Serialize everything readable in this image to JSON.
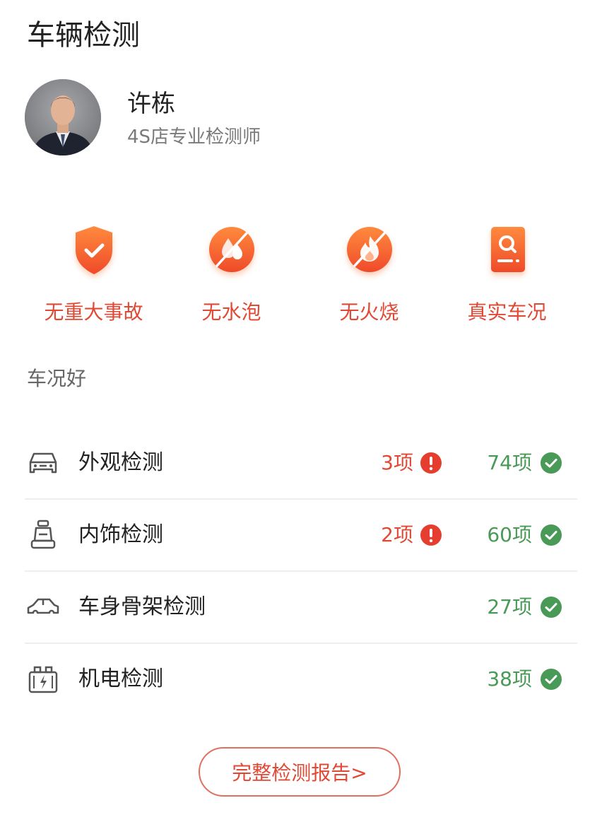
{
  "page": {
    "title": "车辆检测"
  },
  "inspector": {
    "name": "许栋",
    "title": "4S店专业检测师"
  },
  "badges": [
    {
      "icon": "shield-check-icon",
      "label": "无重大事故"
    },
    {
      "icon": "no-water-icon",
      "label": "无水泡"
    },
    {
      "icon": "no-fire-icon",
      "label": "无火烧"
    },
    {
      "icon": "report-search-icon",
      "label": "真实车况"
    }
  ],
  "summary": {
    "status": "车况好"
  },
  "items": [
    {
      "icon": "car-front-icon",
      "label": "外观检测",
      "warn": "3项",
      "pass": "74项"
    },
    {
      "icon": "car-seat-icon",
      "label": "内饰检测",
      "warn": "2项",
      "pass": "60项"
    },
    {
      "icon": "car-body-icon",
      "label": "车身骨架检测",
      "warn": null,
      "pass": "27项"
    },
    {
      "icon": "battery-icon",
      "label": "机电检测",
      "warn": null,
      "pass": "38项"
    }
  ],
  "report_button": {
    "label": "完整检测报告>"
  },
  "colors": {
    "accent": "#e04a35",
    "pass": "#4a9a57",
    "badge_gradient_top": "#ff8a3d",
    "badge_gradient_bottom": "#ef4a2a"
  }
}
